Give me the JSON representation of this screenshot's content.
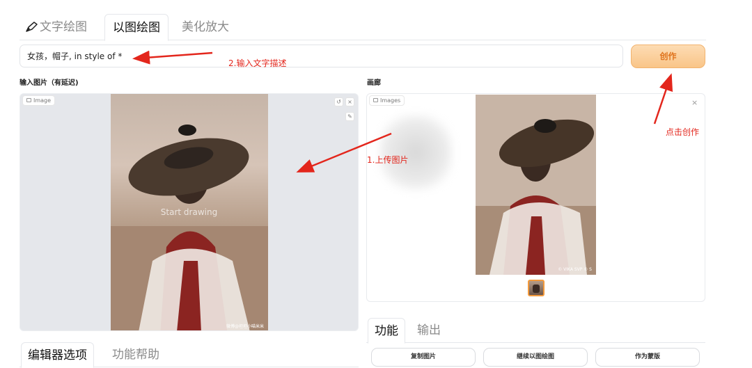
{
  "tabs": [
    {
      "label": "文字绘图",
      "icon": "pencil-icon"
    },
    {
      "label": "以图绘图"
    },
    {
      "label": "美化放大"
    }
  ],
  "prompt": {
    "value": "女孩，帽子, in style of *"
  },
  "create_button": "创作",
  "input_section": {
    "label": "输入图片（有延迟)",
    "badge": "Image",
    "placeholder": "Start drawing",
    "watermark": "微博@坦坦小喵米米"
  },
  "gallery_section": {
    "label": "画廊",
    "badge": "Images",
    "watermark": "© VIKA SVP © S"
  },
  "bottom_left_tabs": [
    "编辑器选项",
    "功能帮助"
  ],
  "bottom_right_tabs": [
    "功能",
    "输出"
  ],
  "function_buttons": [
    "复制图片",
    "继续以图绘图",
    "作为蒙版"
  ],
  "annotations": {
    "step1": "1.上传图片",
    "step2": "2.输入文字描述",
    "step3": "点击创作"
  },
  "colors": {
    "annotation": "#e3261c",
    "create_button": "#f9c588",
    "thumb_border": "#f39a3c"
  }
}
